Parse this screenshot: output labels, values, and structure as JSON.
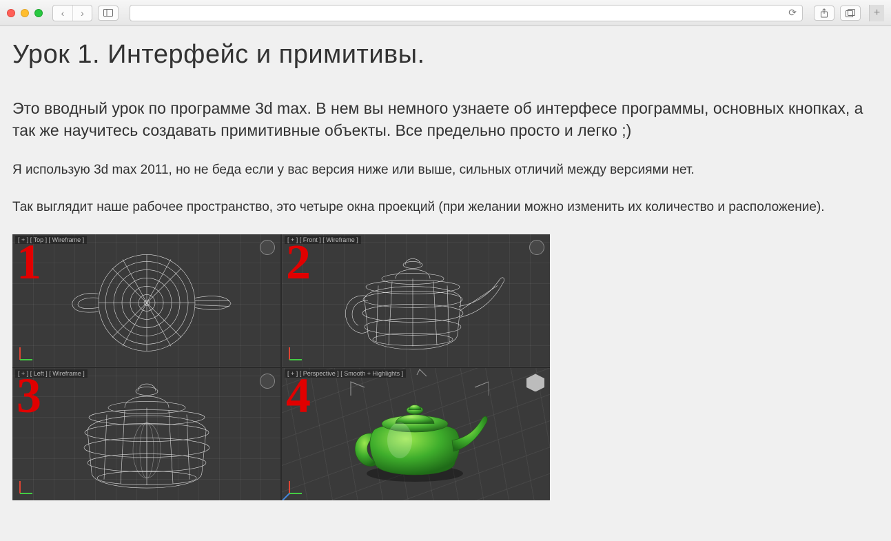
{
  "browser": {
    "address": "",
    "reload_glyph": "⟳",
    "back_glyph": "‹",
    "forward_glyph": "›",
    "sidebar_glyph": "▣",
    "share_glyph": "⇪",
    "tabs_glyph": "⧉",
    "newtab_glyph": "+"
  },
  "article": {
    "title": "Урок 1. Интерфейс и примитивы.",
    "intro": "Это вводный урок по программе 3d max. В нем вы немного узнаете об интерфесе программы, основных кнопках, а так же научитесь создавать примитивные объекты. Все предельно просто и легко ;)",
    "p1": "Я использую 3d max 2011, но не беда если у вас версия ниже или выше, сильных отличий между версиями нет.",
    "p2": "Так выглядит наше рабочее пространство, это четыре окна проекций (при желании можно изменить их количество и расположение)."
  },
  "viewports": [
    {
      "num": "1",
      "label": "[ + ] [ Top ] [ Wireframe ]"
    },
    {
      "num": "2",
      "label": "[ + ] [ Front ] [ Wireframe ]"
    },
    {
      "num": "3",
      "label": "[ + ] [ Left ] [ Wireframe ]"
    },
    {
      "num": "4",
      "label": "[ + ] [ Perspective ] [ Smooth + Highlights ]"
    }
  ]
}
